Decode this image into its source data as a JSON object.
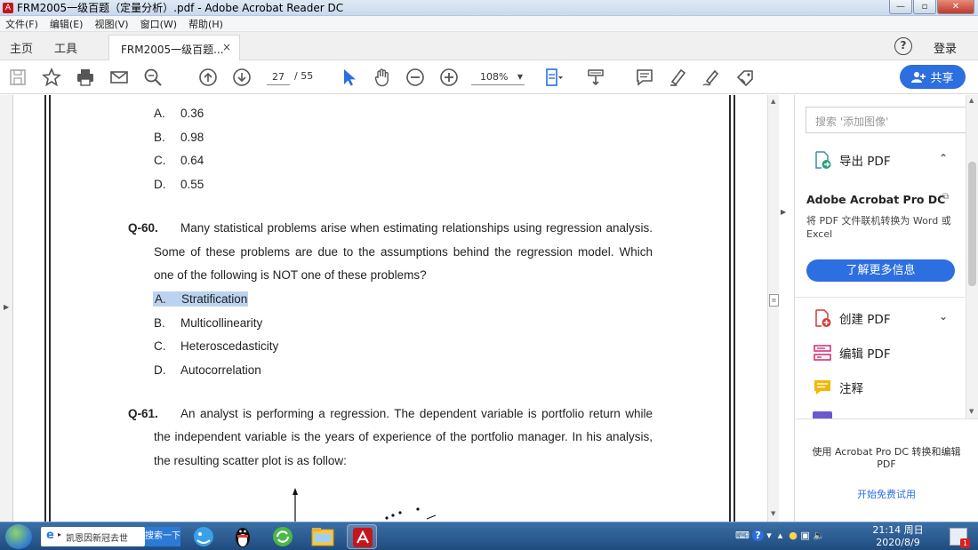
{
  "window": {
    "title": "FRM2005一级百题（定量分析）.pdf - Adobe Acrobat Reader DC",
    "minimize": "—",
    "restore": "▫",
    "close": "✕"
  },
  "menu": [
    "文件(F)",
    "编辑(E)",
    "视图(V)",
    "窗口(W)",
    "帮助(H)"
  ],
  "tabs": {
    "home": "主页",
    "tools": "工具",
    "document": "FRM2005一级百题...",
    "help": "?",
    "login": "登录"
  },
  "toolbar": {
    "page_current": "27",
    "page_total": "/ 55",
    "zoom": "108%",
    "share": "共享"
  },
  "document": {
    "prev_options": [
      {
        "letter": "A.",
        "text": "0.36"
      },
      {
        "letter": "B.",
        "text": "0.98"
      },
      {
        "letter": "C.",
        "text": "0.64"
      },
      {
        "letter": "D.",
        "text": "0.55"
      }
    ],
    "q60": {
      "number": "Q-60.",
      "lines": [
        "Many statistical problems arise when estimating relationships using regression analysis.",
        "Some of these problems are due to the assumptions behind the regression model. Which",
        "one of the following is NOT one of these problems?"
      ],
      "options": [
        {
          "letter": "A.",
          "text": "Stratification",
          "selected": true
        },
        {
          "letter": "B.",
          "text": "Multicollinearity"
        },
        {
          "letter": "C.",
          "text": "Heteroscedasticity"
        },
        {
          "letter": "D.",
          "text": "Autocorrelation"
        }
      ]
    },
    "q61": {
      "number": "Q-61.",
      "lines": [
        "An analyst is performing a regression. The dependent variable is portfolio return while",
        "the independent variable is the years of experience of the portfolio manager. In his analysis,",
        "the resulting scatter plot is as follow:"
      ]
    }
  },
  "right_panel": {
    "search_placeholder": "搜索 '添加图像'",
    "export_pdf": "导出 PDF",
    "promo_title": "Adobe Acrobat Pro DC",
    "promo_desc": "将 PDF 文件联机转换为 Word 或 Excel",
    "promo_button": "了解更多信息",
    "create_pdf": "创建 PDF",
    "edit_pdf": "编辑 PDF",
    "comment": "注释",
    "bottom_text": "使用 Acrobat Pro DC 转换和编辑 PDF",
    "bottom_link": "开始免费试用"
  },
  "taskbar": {
    "search_text": "凯恩因新冠去世",
    "search_button": "搜索一下",
    "time": "21:14 周日",
    "date": "2020/8/9",
    "notify_count": "1"
  },
  "colors": {
    "accent": "#2d6ee0",
    "selection": "#bcd3f0",
    "taskbar": "#1f4c7f"
  }
}
